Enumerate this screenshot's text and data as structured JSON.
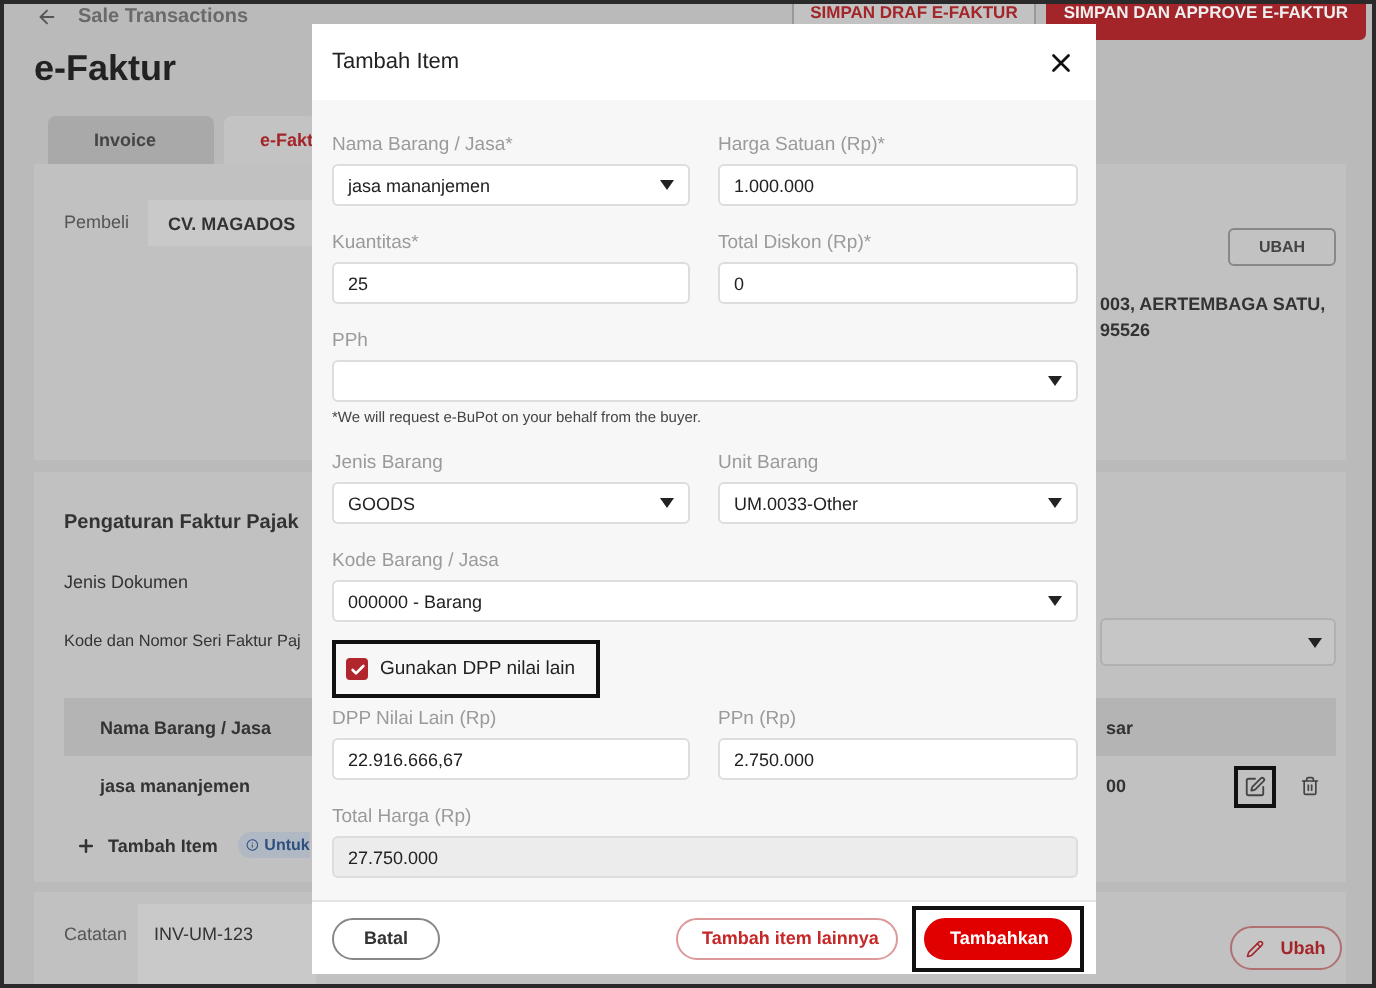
{
  "header": {
    "back_label": "Sale Transactions",
    "buttons": [
      {
        "label": "SIMPAN DRAF E-FAKTUR",
        "kind": "outline"
      },
      {
        "label": "SIMPAN DAN APPROVE E-FAKTUR",
        "kind": "primary"
      }
    ]
  },
  "page_title": "e-Faktur",
  "tabs": [
    {
      "label": "Invoice",
      "selected": false
    },
    {
      "label": "e-Fakt",
      "selected": true
    }
  ],
  "buyer": {
    "label": "Pembeli",
    "value": "CV. MAGADOS",
    "button": "UBAH",
    "address_lines": [
      "003, AERTEMBAGA SATU,",
      "95526"
    ]
  },
  "tax_settings": {
    "title": "Pengaturan Faktur Pajak",
    "labels": [
      "Jenis Dokumen",
      "Kode dan Nomor Seri Faktur Paj"
    ]
  },
  "items_table": {
    "columns": [
      "Nama Barang / Jasa",
      "sar"
    ],
    "rows": [
      {
        "cells": [
          "jasa mananjemen",
          "00"
        ],
        "edit_highlighted": true
      }
    ]
  },
  "add_item": "Tambah Item",
  "info_badge": "Untuk",
  "notes": {
    "label": "Catatan",
    "value": "INV-UM-123",
    "button": "Ubah"
  },
  "modal": {
    "title": "Tambah Item",
    "rows": [
      [
        {
          "kind": "select",
          "label": "Nama Barang / Jasa*",
          "value": "jasa mananjemen"
        },
        {
          "kind": "input",
          "label": "Harga Satuan (Rp)*",
          "value": "1.000.000"
        }
      ],
      [
        {
          "kind": "input",
          "label": "Kuantitas*",
          "value": "25"
        },
        {
          "kind": "input",
          "label": "Total Diskon (Rp)*",
          "value": "0"
        }
      ],
      [
        {
          "kind": "select",
          "label": "PPh",
          "help": "*We will request e-BuPot on your behalf from the buyer."
        }
      ],
      [
        {
          "kind": "select",
          "label": "Jenis Barang",
          "value": "GOODS"
        },
        {
          "kind": "select",
          "label": "Unit Barang",
          "value": "UM.0033-Other"
        }
      ],
      [
        {
          "kind": "select",
          "label": "Kode Barang / Jasa",
          "value": "000000 - Barang"
        }
      ],
      [
        {
          "kind": "checkbox",
          "label": "Gunakan DPP nilai lain",
          "checked": true,
          "highlighted": true
        }
      ],
      [
        {
          "kind": "input",
          "label": "DPP Nilai Lain (Rp)",
          "value": "22.916.666,67"
        },
        {
          "kind": "input",
          "label": "PPn (Rp)",
          "value": "2.750.000"
        }
      ],
      [
        {
          "kind": "readonly",
          "label": "Total Harga (Rp)",
          "value": "27.750.000"
        }
      ]
    ],
    "buttons": [
      {
        "label": "Batal",
        "kind": "secondary",
        "highlighted": false
      },
      {
        "label": "Tambah item lainnya",
        "kind": "outline",
        "highlighted": false
      },
      {
        "label": "Tambahkan",
        "kind": "primary",
        "highlighted": true
      }
    ]
  }
}
